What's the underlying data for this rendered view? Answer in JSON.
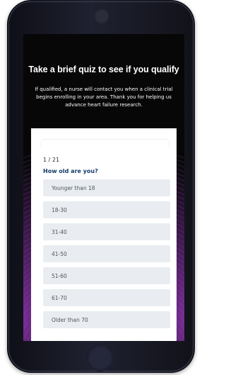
{
  "headline": "Take a brief quiz to see if you qualify",
  "subtext": "If qualified, a nurse will contact you when a clinical trial begins enrolling in your area. Thank you for helping us advance heart failure research.",
  "quiz": {
    "step_counter": "1 / 21",
    "progress_fraction": 0.0476,
    "question": "How old are you?",
    "options": [
      {
        "label": "Younger than 18"
      },
      {
        "label": "18-30"
      },
      {
        "label": "31-40"
      },
      {
        "label": "41-50"
      },
      {
        "label": "51-60"
      },
      {
        "label": "61-70"
      },
      {
        "label": "Older than 70"
      }
    ]
  },
  "colors": {
    "screen_background": "#070708",
    "glow": "#a03cc8",
    "option_background": "#e9edf1",
    "question_text": "#143a6a"
  },
  "icons": {
    "device": "smartphone-frame",
    "top_sensor": "camera-icon",
    "bottom": "home-button"
  }
}
